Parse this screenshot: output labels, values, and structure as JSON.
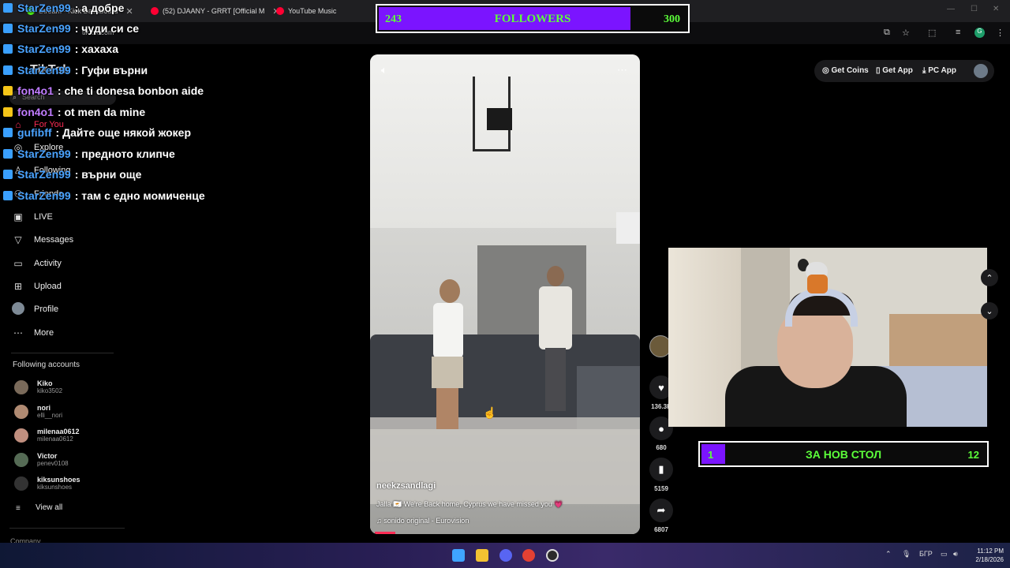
{
  "browser": {
    "tabs": [
      {
        "title": "Stream - Kick Dashboard"
      },
      {
        "title": "(52) DJAANY - GRRT [Official M"
      },
      {
        "title": "YouTube Music"
      }
    ],
    "url": "tiktok.com"
  },
  "tiktok": {
    "logo": "TikTok",
    "search_placeholder": "Search",
    "nav": [
      {
        "label": "For You",
        "icon": "home-icon"
      },
      {
        "label": "Explore",
        "icon": "compass-icon"
      },
      {
        "label": "Following",
        "icon": "following-icon"
      },
      {
        "label": "Friends",
        "icon": "friends-icon"
      },
      {
        "label": "LIVE",
        "icon": "live-icon"
      },
      {
        "label": "Messages",
        "icon": "messages-icon"
      },
      {
        "label": "Activity",
        "icon": "activity-icon"
      },
      {
        "label": "Upload",
        "icon": "upload-icon"
      },
      {
        "label": "Profile",
        "icon": "profile-icon"
      },
      {
        "label": "More",
        "icon": "more-icon"
      }
    ],
    "following_title": "Following accounts",
    "accounts": [
      {
        "name": "Kiko",
        "handle": "kiko3502",
        "color": "#7a6a5a"
      },
      {
        "name": "nori",
        "handle": "elli__nori",
        "color": "#b08a72"
      },
      {
        "name": "milenaa0612",
        "handle": "milenaa0612",
        "color": "#c08f7f"
      },
      {
        "name": "Victor",
        "handle": "penev0108",
        "color": "#556b55"
      },
      {
        "name": "kiksunshoes",
        "handle": "kiksunshoes",
        "color": "#333333"
      }
    ],
    "view_all": "View all",
    "company": "Company",
    "header": {
      "get_coins": "Get Coins",
      "get_app": "Get App",
      "pc_app": "PC App"
    }
  },
  "chat": [
    {
      "user": "StarZen99",
      "msg": "а добре",
      "color": "#4aa3ff",
      "badge": "#3aa0ff"
    },
    {
      "user": "StarZen99",
      "msg": "чуди си се",
      "color": "#4aa3ff",
      "badge": "#3aa0ff"
    },
    {
      "user": "StarZen99",
      "msg": "хахаха",
      "color": "#4aa3ff",
      "badge": "#3aa0ff"
    },
    {
      "user": "StarZen99",
      "msg": "Гуфи върни",
      "color": "#4aa3ff",
      "badge": "#3aa0ff"
    },
    {
      "user": "fon4o1",
      "msg": "che ti donesa bonbon aide",
      "color": "#c07cff",
      "badge": "#f5c518"
    },
    {
      "user": "fon4o1",
      "msg": "ot men da mine",
      "color": "#c07cff",
      "badge": "#f5c518"
    },
    {
      "user": "gufibff",
      "msg": "Дайте още някой жокер",
      "color": "#4aa3ff",
      "badge": "#3aa0ff"
    },
    {
      "user": "StarZen99",
      "msg": "предното клипче",
      "color": "#4aa3ff",
      "badge": "#3aa0ff"
    },
    {
      "user": "StarZen99",
      "msg": "върни още",
      "color": "#4aa3ff",
      "badge": "#3aa0ff"
    },
    {
      "user": "StarZen99",
      "msg": "там с едно момиченце",
      "color": "#4aa3ff",
      "badge": "#3aa0ff"
    }
  ],
  "followers_goal": {
    "current": "243",
    "label": "FOLLOWERS",
    "target": "300",
    "progress": 0.81
  },
  "video": {
    "creator": "neekzsandlagi",
    "caption": "Jalla 🇨🇾 We're Back home, Cyprus we have missed you 💗",
    "music": "sonido original - Eurovision",
    "progress": 0.08
  },
  "actions": {
    "likes": "136.3K",
    "comments": "680",
    "saves": "5159",
    "shares": "6807"
  },
  "chair_goal": {
    "current": "1",
    "label": "ЗА НОВ СТОЛ",
    "target": "12",
    "progress": 0.083
  },
  "taskbar": {
    "language": "БГР",
    "time": "11:12 PM",
    "date": "2/18/2026"
  }
}
